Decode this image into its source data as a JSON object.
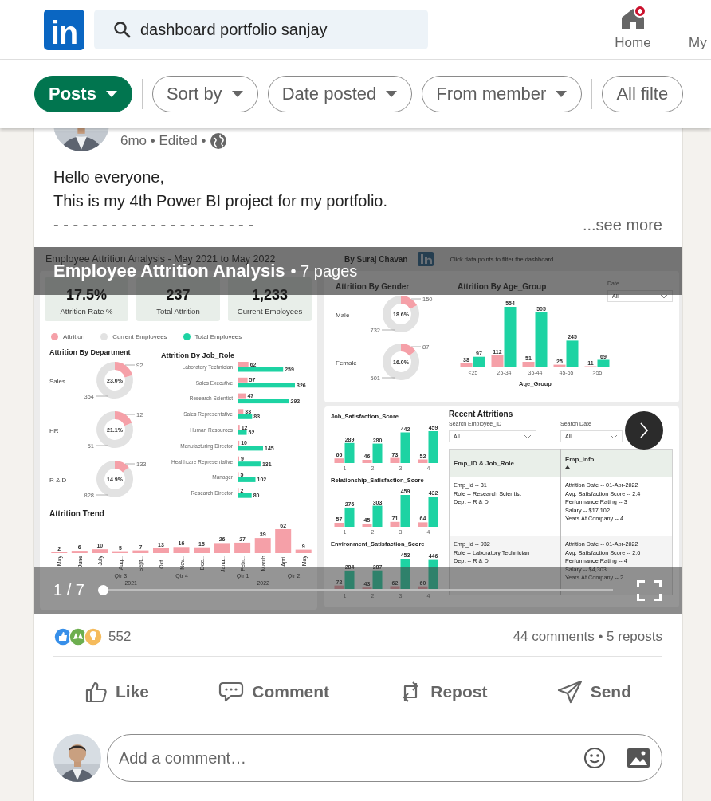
{
  "top_nav": {
    "logo": "in",
    "search": {
      "value": "dashboard portfolio sanjay"
    },
    "items": [
      {
        "label": "Home",
        "notification": true
      },
      {
        "label": "My",
        "notification": false
      }
    ]
  },
  "filter_groups": [
    [
      {
        "label": "Posts",
        "selected": true,
        "dropdown": true
      }
    ],
    [
      {
        "label": "Sort by",
        "selected": false,
        "dropdown": true
      },
      {
        "label": "Date posted",
        "selected": false,
        "dropdown": true
      },
      {
        "label": "From member",
        "selected": false,
        "dropdown": true
      }
    ],
    [
      {
        "label": "All filte",
        "selected": false,
        "dropdown": false
      }
    ]
  ],
  "post": {
    "meta": "6mo • Edited •",
    "body": [
      "Hello everyone,",
      "This is my 4th Power BI project for my portfolio.",
      "- - - - - - - - - - - - - - - - - - - - -"
    ],
    "see_more": "...see more",
    "document": {
      "title": "Employee Attrition Analysis",
      "pages": "• 7 pages",
      "counter": "1 / 7",
      "level": 0,
      "dashboard": {
        "title": "Employee Attrition Analysis - May 2021 to May 2022",
        "author": "By Suraj Chavan",
        "hint": "Click data points to filter the dashboard",
        "kpis": [
          {
            "value": "17.5%",
            "label": "Attrition Rate %"
          },
          {
            "value": "237",
            "label": "Total Attrition"
          },
          {
            "value": "1,233",
            "label": "Current Employees"
          }
        ],
        "legend": [
          {
            "label": "Attrition",
            "color": "#f5a0a8"
          },
          {
            "label": "Current Employees",
            "color": "#e2e2e2"
          },
          {
            "label": "Total Employees",
            "color": "#1dd3a3"
          }
        ],
        "department": {
          "title": "Attrition By Department",
          "donuts": [
            {
              "label": "Sales",
              "percent": "23.0%",
              "chart_data": {
                "type": "donut",
                "values": [
                  92,
                  354
                ],
                "data_labels": true
              }
            },
            {
              "label": "HR",
              "percent": "21.1%",
              "chart_data": {
                "type": "donut",
                "values": [
                  12,
                  51
                ],
                "data_labels": true
              }
            },
            {
              "label": "R & D",
              "percent": "14.9%",
              "chart_data": {
                "type": "donut",
                "values": [
                  133,
                  828
                ],
                "data_labels": true
              }
            }
          ]
        },
        "job_role": {
          "chart_data": {
            "type": "bar",
            "orientation": "horizontal",
            "title": "Attrition By Job_Role",
            "categories": [
              "Laboratory Technician",
              "Sales Executive",
              "Research Scientist",
              "Sales Representative",
              "Human Resources",
              "Manufacturing Director",
              "Healthcare Representative",
              "Manager",
              "Research Director"
            ],
            "data_labels": true,
            "series": [
              {
                "color": "#f5a0a8",
                "values": [
                  62,
                  57,
                  47,
                  33,
                  12,
                  10,
                  9,
                  5,
                  2
                ]
              },
              {
                "color": "#1dd3a3",
                "values": [
                  259,
                  326,
                  292,
                  83,
                  52,
                  145,
                  131,
                  102,
                  80
                ]
              }
            ]
          }
        },
        "trend": {
          "chart_data": {
            "type": "bar",
            "title": "Attrition Trend",
            "categories": [
              "May",
              "June",
              "July",
              "Aug...",
              "Sept...",
              "Oct...",
              "Nov...",
              "Dec...",
              "Janu...",
              "Febr...",
              "March",
              "April",
              "May"
            ],
            "data_labels": true,
            "series": [
              {
                "color": "#f5a0a8",
                "values": [
                  2,
                  6,
                  10,
                  5,
                  7,
                  13,
                  16,
                  15,
                  26,
                  27,
                  39,
                  62,
                  9
                ]
              }
            ]
          },
          "quarters": [
            "Qtr 3",
            "Qtr 4",
            "Qtr 1",
            "Qtr 2"
          ],
          "years": [
            "2021",
            "2022"
          ]
        },
        "gender": {
          "title": "Attrition By Gender",
          "donuts": [
            {
              "label": "Male",
              "percent": "18.6%",
              "chart_data": {
                "type": "donut",
                "values": [
                  150,
                  732
                ],
                "data_labels": true
              }
            },
            {
              "label": "Female",
              "percent": "16.0%",
              "chart_data": {
                "type": "donut",
                "values": [
                  87,
                  501
                ],
                "data_labels": true
              }
            }
          ]
        },
        "age_group": {
          "chart_data": {
            "type": "bar",
            "title": "Attrition By Age_Group",
            "xlabel": "Age_Group",
            "categories": [
              "<25",
              "25-34",
              "35-44",
              "45-55",
              ">55"
            ],
            "data_labels": true,
            "series": [
              {
                "color": "#f5a0a8",
                "values": [
                  38,
                  112,
                  51,
                  25,
                  11
                ]
              },
              {
                "color": "#1dd3a3",
                "values": [
                  97,
                  554,
                  505,
                  245,
                  69
                ]
              }
            ]
          }
        },
        "date_slicer": {
          "label": "Date",
          "value": "All"
        },
        "satisfaction": [
          {
            "chart_data": {
              "type": "bar",
              "title": "Job_Satisfaction_Score",
              "categories": [
                "1",
                "2",
                "3",
                "4"
              ],
              "data_labels": true,
              "series": [
                {
                  "color": "#f5a0a8",
                  "values": [
                    66,
                    46,
                    73,
                    52
                  ]
                },
                {
                  "color": "#1dd3a3",
                  "values": [
                    289,
                    280,
                    442,
                    459
                  ]
                }
              ]
            }
          },
          {
            "chart_data": {
              "type": "bar",
              "title": "Relationship_Satisfaction_Score",
              "categories": [
                "1",
                "2",
                "3",
                "4"
              ],
              "data_labels": true,
              "series": [
                {
                  "color": "#f5a0a8",
                  "values": [
                    57,
                    45,
                    71,
                    64
                  ]
                },
                {
                  "color": "#1dd3a3",
                  "values": [
                    276,
                    303,
                    459,
                    432
                  ]
                }
              ]
            }
          },
          {
            "chart_data": {
              "type": "bar",
              "title": "Environment_Satisfaction_Score",
              "categories": [
                "1",
                "2",
                "3",
                "4"
              ],
              "data_labels": true,
              "series": [
                {
                  "color": "#f5a0a8",
                  "values": [
                    72,
                    43,
                    62,
                    60
                  ]
                },
                {
                  "color": "#1dd3a3",
                  "values": [
                    284,
                    287,
                    453,
                    446
                  ]
                }
              ]
            }
          }
        ],
        "recent": {
          "title": "Recent Attritions",
          "slicers": [
            {
              "label": "Search Employee_ID",
              "value": "All"
            },
            {
              "label": "Search Date",
              "value": "All"
            }
          ],
          "columns": [
            "Emp_ID & Job_Role",
            "Emp_info"
          ],
          "rows": [
            [
              [
                "Emp_id -- 31",
                "Role -- Research Scientist",
                "Dept -- R & D"
              ],
              [
                "Attrition Date -- 01-Apr-2022",
                "Avg. Satisfaction Score -- 2.4",
                "Performance Rating -- 3",
                "Salary -- $17,102",
                "Years At Company -- 4"
              ]
            ],
            [
              [
                "Emp_id -- 932",
                "Role -- Laboratory Technician",
                "Dept -- R & D"
              ],
              [
                "Attrition Date -- 01-Apr-2022",
                "Avg. Satisfaction Score -- 2.6",
                "Performance Rating -- 4",
                "Salary -- $4,303",
                "Years At Company -- 2"
              ]
            ]
          ]
        }
      }
    },
    "stats": {
      "reactions": "552",
      "counts": "44 comments • 5 reposts"
    },
    "actions": [
      {
        "label": "Like",
        "kind": "like"
      },
      {
        "label": "Comment",
        "kind": "comment"
      },
      {
        "label": "Repost",
        "kind": "repost"
      },
      {
        "label": "Send",
        "kind": "send"
      }
    ],
    "comment_box": {
      "placeholder": "Add a comment…"
    }
  }
}
